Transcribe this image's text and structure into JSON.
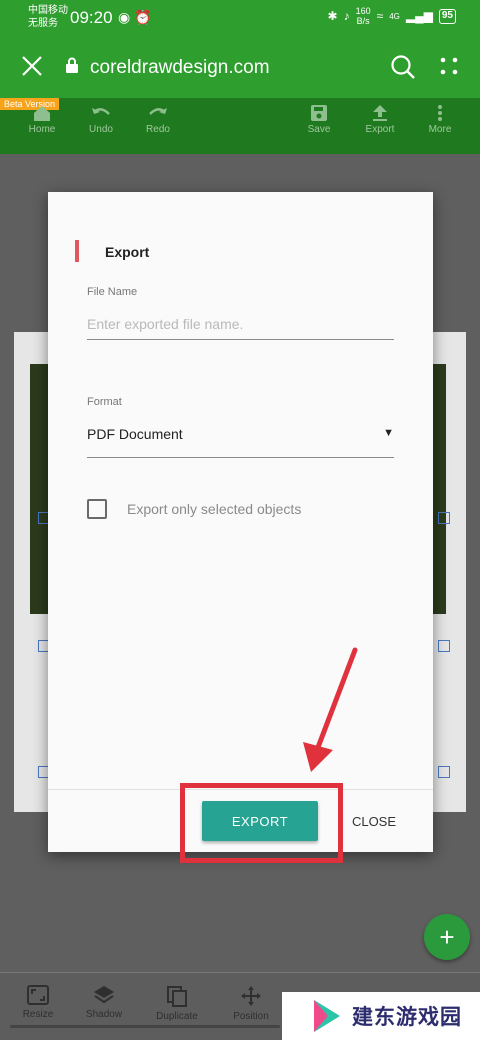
{
  "status_bar": {
    "carrier_line1": "中国移动",
    "carrier_line2": "无服务",
    "time": "09:20",
    "speed_value": "160",
    "speed_unit": "B/s",
    "network": "4G",
    "battery": "95"
  },
  "browser": {
    "url": "coreldrawdesign.com",
    "icons": [
      "close-icon",
      "lock-icon",
      "search-icon",
      "more-vert-icon"
    ]
  },
  "app_toolbar": {
    "beta_label": "Beta Version",
    "home": "Home",
    "undo": "Undo",
    "redo": "Redo",
    "save": "Save",
    "export": "Export",
    "more": "More"
  },
  "dialog": {
    "title": "Export",
    "file_name_label": "File Name",
    "file_name_placeholder": "Enter exported file name.",
    "file_name_value": "",
    "format_label": "Format",
    "format_value": "PDF Document",
    "checkbox_label": "Export only selected objects",
    "checkbox_checked": false,
    "export_button": "EXPORT",
    "close_button": "CLOSE"
  },
  "fab": {
    "label": "+"
  },
  "bottom_toolbar": {
    "resize": "Resize",
    "shadow": "Shadow",
    "duplicate": "Duplicate",
    "position": "Position"
  },
  "watermark": {
    "text": "建东游戏园"
  },
  "colors": {
    "header_green": "#2e9e2e",
    "toolbar_green": "#1f7a1f",
    "beta_orange": "#f6a41b",
    "accent_red": "#e0585d",
    "export_teal": "#27a393",
    "annotation_red": "#e0323d"
  }
}
